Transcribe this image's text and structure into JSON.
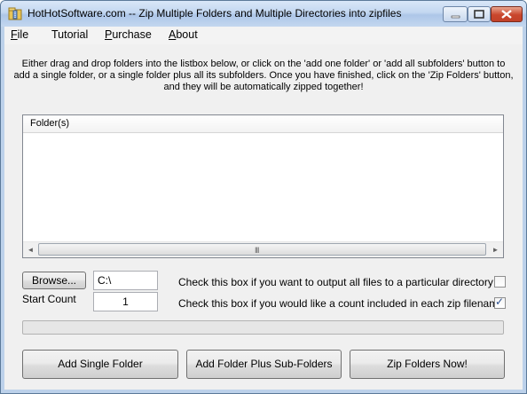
{
  "window": {
    "title": "HotHotSoftware.com -- Zip Multiple Folders and Multiple Directories into zipfiles",
    "icon": "zip-folder-icon"
  },
  "menu": [
    {
      "accel": "F",
      "rest": "ile"
    },
    {
      "accel": "",
      "rest": "Tutorial"
    },
    {
      "accel": "P",
      "rest": "urchase"
    },
    {
      "accel": "A",
      "rest": "bout"
    }
  ],
  "instructions": [
    "Either drag and drop folders into the listbox below, or click on the 'add one folder' or 'add all subfolders' button to",
    "add a single folder, or a single folder plus all its subfolders. Once you have finished, click on the 'Zip Folders' button,",
    "and they will be automatically zipped together!"
  ],
  "listbox": {
    "header": "Folder(s)",
    "scroll_grip": "III"
  },
  "browse": {
    "label": "Browse...",
    "path": "C:\\"
  },
  "start_count": {
    "label": "Start Count",
    "value": "1"
  },
  "options": {
    "output_dir_label": "Check this box if you want to output all files to a particular directory",
    "output_dir_checked": false,
    "count_label": "Check this box if you would like a count included in each zip filename",
    "count_checked": true
  },
  "progress": {
    "fraction": 0
  },
  "buttons": {
    "add_single": "Add Single Folder",
    "add_sub": "Add Folder Plus Sub-Folders",
    "zip_now": "Zip Folders Now!"
  },
  "colors": {
    "progress_fill": "#37b33c",
    "titlebar": "#c3d7f0"
  }
}
